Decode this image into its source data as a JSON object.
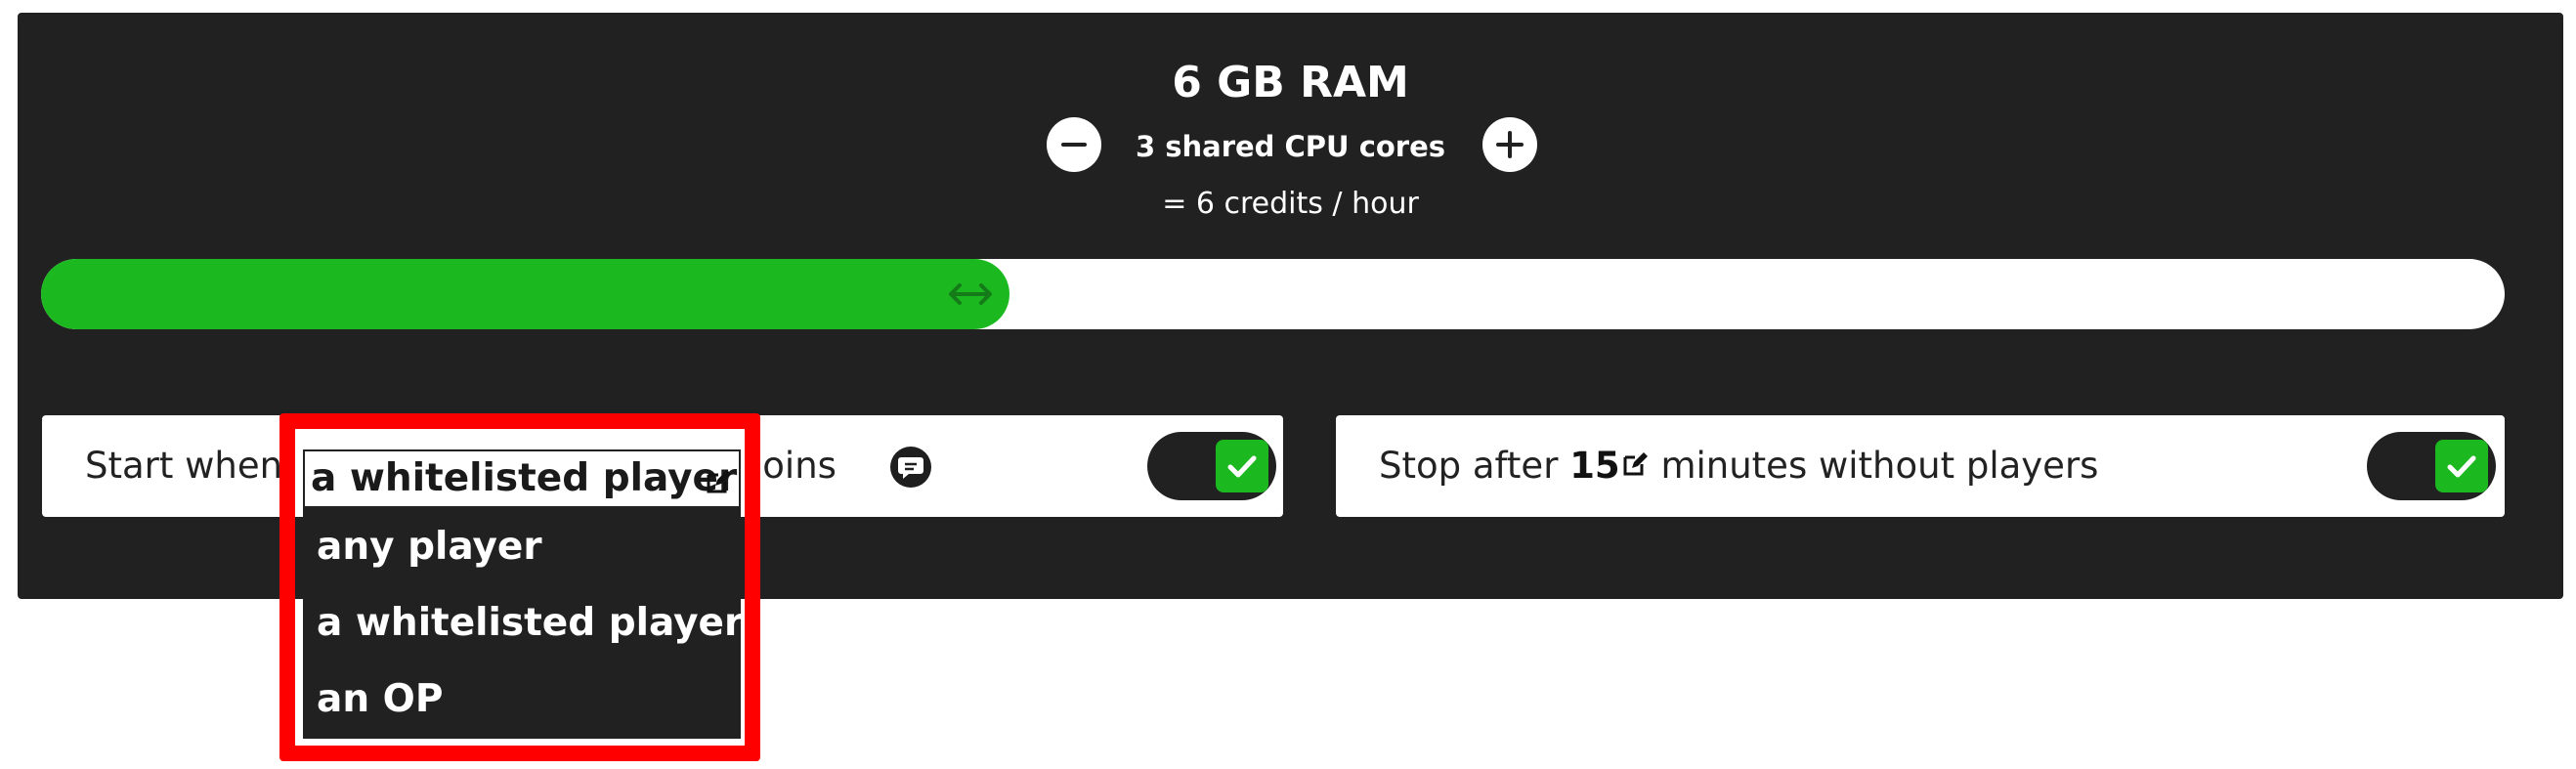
{
  "resources": {
    "ram": "6 GB RAM",
    "cpu": "3 shared CPU cores",
    "cost": "= 6 credits / hour",
    "decrease_icon": "minus-icon",
    "increase_icon": "plus-icon"
  },
  "slider": {
    "level_percent": 39.3,
    "handle_icon": "left-right-arrow-icon",
    "fill_color": "#1bb91f",
    "track_color": "#ffffff"
  },
  "autostart": {
    "prefix": "Start when",
    "suffix": "joins",
    "selected": "a whitelisted player",
    "options": [
      "any player",
      "a whitelisted player",
      "an OP"
    ],
    "enabled": true,
    "info_icon": "chat-bubble-icon",
    "edit_icon": "edit-icon"
  },
  "autostop": {
    "prefix": "Stop after",
    "minutes": "15",
    "suffix": "minutes without players",
    "enabled": true,
    "edit_icon": "edit-icon"
  },
  "colors": {
    "panel": "#212121",
    "accent": "#1bb91f",
    "highlight": "#ff0000"
  }
}
